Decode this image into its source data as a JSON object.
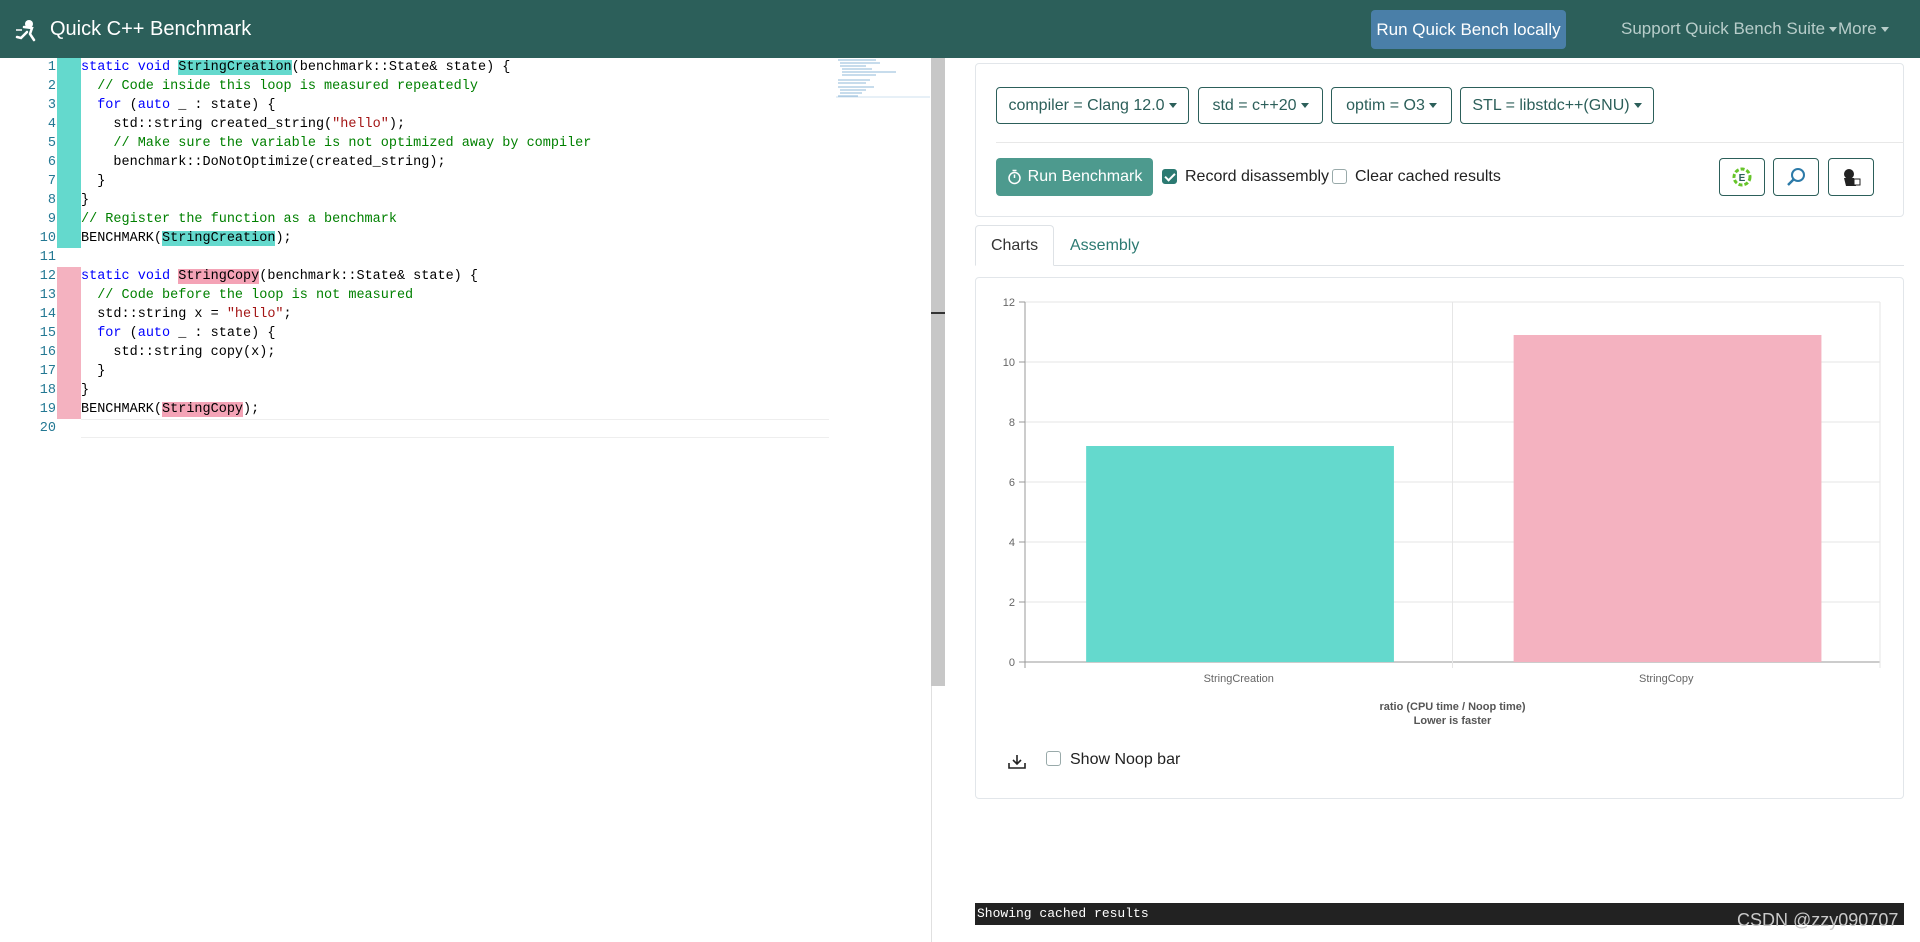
{
  "navbar": {
    "brand": "Quick C++ Benchmark",
    "run_local": "Run Quick Bench locally",
    "support": "Support Quick Bench Suite",
    "more": "More"
  },
  "editor": {
    "line_numbers": [
      "1",
      "2",
      "3",
      "4",
      "5",
      "6",
      "7",
      "8",
      "9",
      "10",
      "11",
      "12",
      "13",
      "14",
      "15",
      "16",
      "17",
      "18",
      "19",
      "20"
    ]
  },
  "options": {
    "compiler": "compiler = Clang 12.0",
    "std": "std = c++20",
    "optim": "optim = O3",
    "stl": "STL = libstdc++(GNU)",
    "run_button": "Run Benchmark",
    "record_disassembly": "Record disassembly",
    "record_disassembly_checked": true,
    "clear_cache": "Clear cached results",
    "clear_cache_checked": false
  },
  "tabs": {
    "charts": "Charts",
    "assembly": "Assembly"
  },
  "chart_data": {
    "type": "bar",
    "categories": [
      "StringCreation",
      "StringCopy"
    ],
    "values": [
      7.2,
      10.9
    ],
    "colors": [
      "#64d9cd",
      "#f4b2c0"
    ],
    "ylim": [
      0,
      12
    ],
    "yticks": [
      "0",
      "2",
      "4",
      "6",
      "8",
      "10",
      "12"
    ],
    "xlabel": "ratio (CPU time / Noop time)",
    "xlabel2": "Lower is faster",
    "grid": true
  },
  "show_noop": {
    "label": "Show Noop bar",
    "checked": false
  },
  "console": {
    "text": "Showing cached results"
  },
  "watermark": "CSDN @zzy090707"
}
